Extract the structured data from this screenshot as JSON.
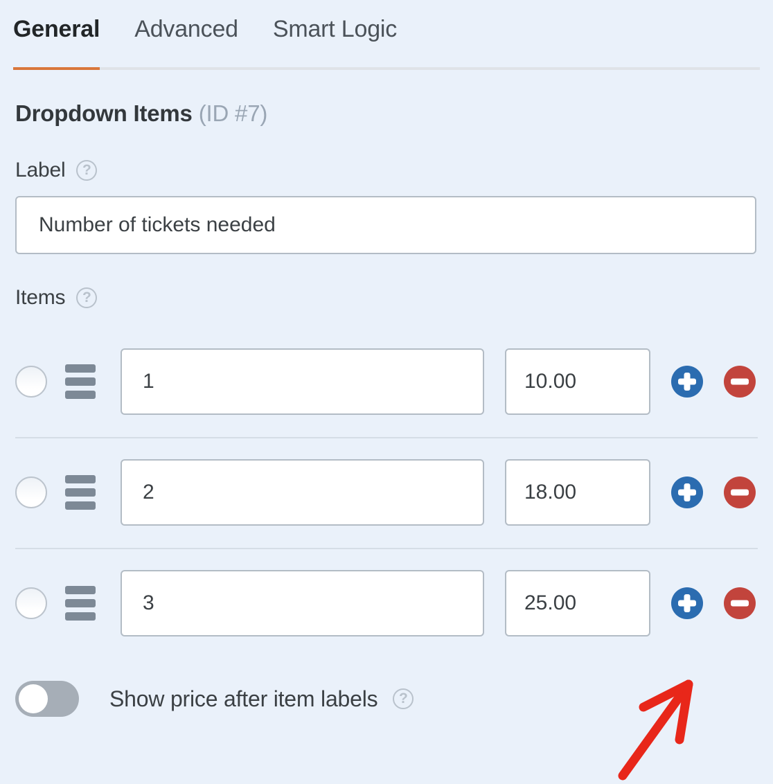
{
  "tabs": [
    {
      "label": "General",
      "active": true
    },
    {
      "label": "Advanced",
      "active": false
    },
    {
      "label": "Smart Logic",
      "active": false
    }
  ],
  "section": {
    "title": "Dropdown Items",
    "id_text": "(ID #7)"
  },
  "label_field": {
    "label": "Label",
    "help_icon": "question-mark-circle-icon",
    "help_glyph": "?",
    "value": "Number of tickets needed",
    "placeholder": ""
  },
  "items_field": {
    "label": "Items",
    "help_icon": "question-mark-circle-icon",
    "help_glyph": "?",
    "rows": [
      {
        "selected": false,
        "value": "1",
        "price": "10.00"
      },
      {
        "selected": false,
        "value": "2",
        "price": "18.00"
      },
      {
        "selected": false,
        "value": "3",
        "price": "25.00"
      }
    ],
    "add_button_label": "+",
    "remove_button_label": "-"
  },
  "show_price_toggle": {
    "label": "Show price after item labels",
    "state": "off",
    "help_glyph": "?"
  },
  "annotation": {
    "type": "arrow",
    "color": "#e8271a",
    "points_to": "add-item-button-row-3"
  },
  "colors": {
    "background": "#eaf1fa",
    "accent_orange": "#d9773b",
    "add_blue": "#2b6cb0",
    "remove_red": "#c2443c",
    "toggle_off_gray": "#a6aeb7",
    "border_gray": "#b3bcc5"
  }
}
